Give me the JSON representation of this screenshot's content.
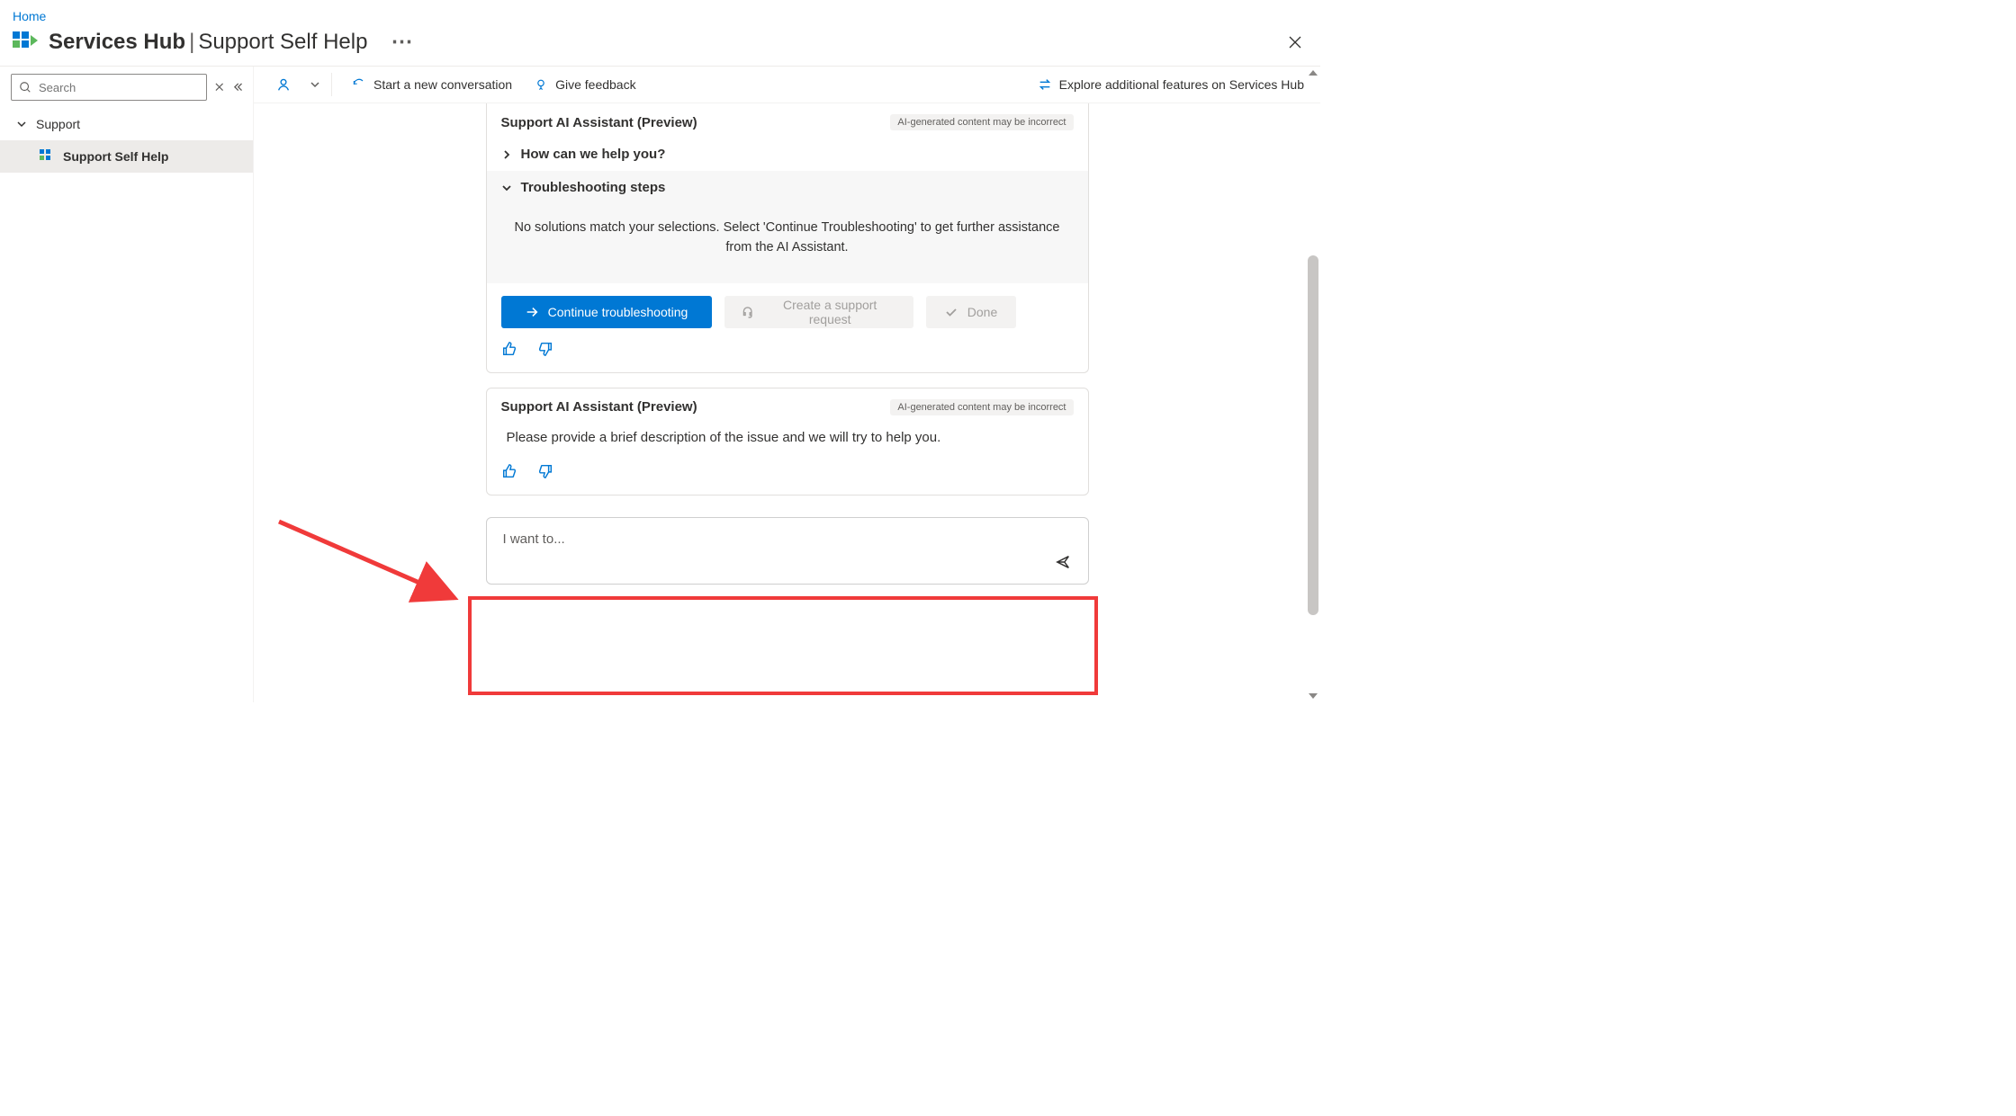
{
  "breadcrumb": {
    "home": "Home"
  },
  "header": {
    "title_main": "Services Hub",
    "title_sub": "Support Self Help"
  },
  "sidebar": {
    "search_placeholder": "Search",
    "root_label": "Support",
    "item_label": "Support Self Help"
  },
  "toolbar": {
    "start_new": "Start a new conversation",
    "give_feedback": "Give feedback",
    "explore": "Explore additional features on Services Hub"
  },
  "chat": {
    "assistant_name": "Support AI Assistant (Preview)",
    "ai_disclaimer": "AI-generated content may be incorrect",
    "how_help": "How can we help you?",
    "troubleshooting_header": "Troubleshooting steps",
    "no_solutions": "No solutions match your selections. Select 'Continue Troubleshooting' to get further assistance from the AI Assistant.",
    "continue_btn": "Continue troubleshooting",
    "create_request_btn": "Create a support request",
    "done_btn": "Done",
    "prompt_description": "Please provide a brief description of the issue and we will try to help you.",
    "input_placeholder": "I want to..."
  }
}
